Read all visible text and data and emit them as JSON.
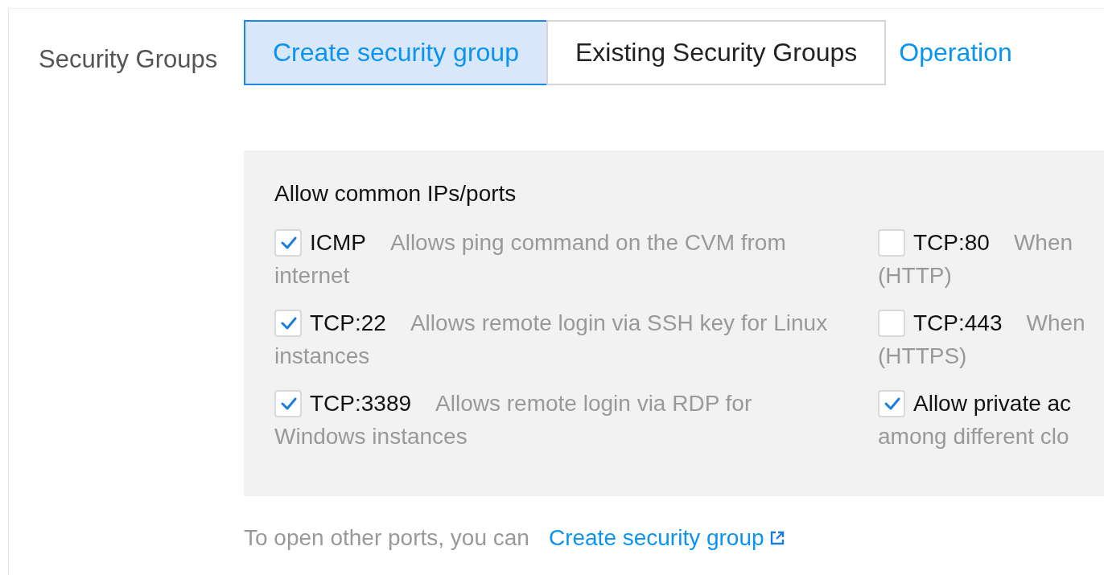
{
  "field_label": "Security Groups",
  "tabs": [
    {
      "label": "Create security group",
      "kind": "tab",
      "selected": true
    },
    {
      "label": "Existing Security Groups",
      "kind": "tab",
      "selected": false
    },
    {
      "label": "Operation",
      "kind": "link",
      "selected": false
    }
  ],
  "panel": {
    "title": "Allow common IPs/ports",
    "columns": [
      [
        {
          "label": "ICMP",
          "description": "Allows ping command on the CVM from",
          "continuation": "internet",
          "checked": true
        },
        {
          "label": "TCP:22",
          "description": "Allows remote login via SSH key for Linux",
          "continuation": "instances",
          "checked": true
        },
        {
          "label": "TCP:3389",
          "description": "Allows remote login via RDP for",
          "continuation": "Windows instances",
          "checked": true
        }
      ],
      [
        {
          "label": "TCP:80",
          "description": "When",
          "continuation": "(HTTP)",
          "checked": false
        },
        {
          "label": "TCP:443",
          "description": "When",
          "continuation": "(HTTPS)",
          "checked": false
        },
        {
          "label": "Allow private ac",
          "continuation": "among different clo",
          "checked": true
        }
      ]
    ]
  },
  "footer": {
    "text": "To open other ports, you can",
    "link": "Create security group"
  }
}
